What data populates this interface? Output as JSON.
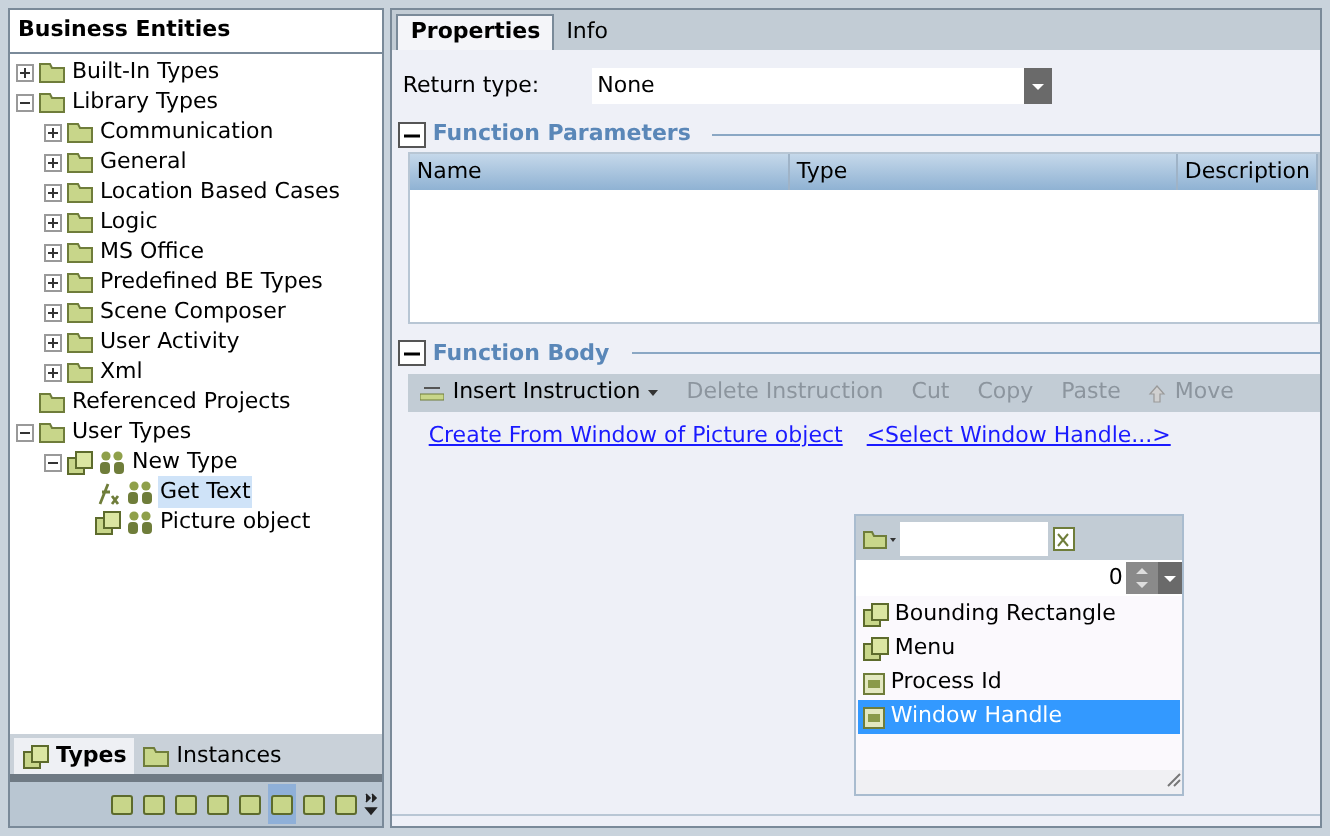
{
  "left_panel": {
    "title": "Business Entities",
    "tree": [
      {
        "label": "Built-In Types",
        "kind": "folder",
        "expanded": false,
        "selected": false
      },
      {
        "label": "Library Types",
        "kind": "folder",
        "expanded": true,
        "selected": false,
        "children": [
          {
            "label": "Communication",
            "kind": "folder",
            "expanded": false,
            "selected": false
          },
          {
            "label": "General",
            "kind": "folder",
            "expanded": false,
            "selected": false
          },
          {
            "label": "Location Based Cases",
            "kind": "folder",
            "expanded": false,
            "selected": false
          },
          {
            "label": "Logic",
            "kind": "folder",
            "expanded": false,
            "selected": false
          },
          {
            "label": "MS Office",
            "kind": "folder",
            "expanded": false,
            "selected": false
          },
          {
            "label": "Predefined BE Types",
            "kind": "folder",
            "expanded": false,
            "selected": false
          },
          {
            "label": "Scene Composer",
            "kind": "folder",
            "expanded": false,
            "selected": false
          },
          {
            "label": "User Activity",
            "kind": "folder",
            "expanded": false,
            "selected": false
          },
          {
            "label": "Xml",
            "kind": "folder",
            "expanded": false,
            "selected": false
          }
        ]
      },
      {
        "label": "Referenced Projects",
        "kind": "folder",
        "selected": false
      },
      {
        "label": "User Types",
        "kind": "folder",
        "expanded": true,
        "selected": false,
        "children": [
          {
            "label": "New Type",
            "kind": "type",
            "expanded": true,
            "selected": false,
            "children": [
              {
                "label": "Get Text",
                "kind": "function",
                "selected": true
              },
              {
                "label": "Picture object",
                "kind": "type",
                "selected": false
              }
            ]
          }
        ]
      }
    ],
    "tabs": [
      {
        "label": "Types",
        "selected": true
      },
      {
        "label": "Instances",
        "selected": false
      }
    ],
    "toolbar": [
      {
        "selected": false
      },
      {
        "selected": false
      },
      {
        "selected": false
      },
      {
        "selected": false
      },
      {
        "selected": false
      },
      {
        "selected": true
      },
      {
        "selected": false
      },
      {
        "selected": false
      }
    ]
  },
  "right_panel": {
    "tabs": [
      {
        "label": "Properties",
        "selected": true
      },
      {
        "label": "Info",
        "selected": false
      }
    ],
    "return_type": {
      "label": "Return type:",
      "value": "None"
    },
    "parameters": {
      "title": "Function Parameters",
      "columns": [
        "Name",
        "Type",
        "Description"
      ]
    },
    "body": {
      "title": "Function Body",
      "toolbar": [
        {
          "label": "Insert Instruction",
          "kind": "menu",
          "disabled": false
        },
        {
          "label": "Delete Instruction",
          "kind": "plain",
          "disabled": true
        },
        {
          "label": "Cut",
          "kind": "plain",
          "disabled": true
        },
        {
          "label": "Copy",
          "kind": "plain",
          "disabled": true
        },
        {
          "label": "Paste",
          "kind": "plain",
          "disabled": true
        },
        {
          "label": "Move",
          "kind": "move",
          "disabled": true
        }
      ],
      "links": [
        "Create From Window of Picture object",
        "<Select  Window Handle...>"
      ],
      "popup": {
        "spinner_value": "0",
        "items": [
          {
            "label": "Bounding Rectangle",
            "kind": "type",
            "selected": false
          },
          {
            "label": "Menu",
            "kind": "type",
            "selected": false
          },
          {
            "label": "Process Id",
            "kind": "field",
            "selected": false
          },
          {
            "label": "Window Handle",
            "kind": "field",
            "selected": true
          }
        ]
      }
    }
  }
}
